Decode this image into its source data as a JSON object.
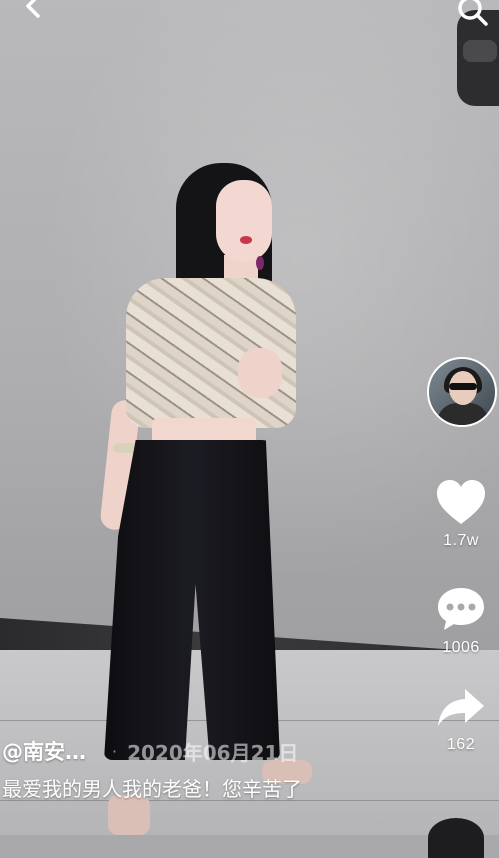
{
  "video": {
    "author": "@南安…",
    "separator": "·",
    "date": "2020年06月21日",
    "description": "最爱我的男人我的老爸！您辛苦了"
  },
  "actions": {
    "like_count": "1.7w",
    "comment_count": "1006",
    "share_count": "162"
  },
  "colors": {
    "overlay_text": "#ffffff",
    "date_text": "#d9d9d9"
  },
  "icons": {
    "back": "chevron-left-icon",
    "search": "search-icon",
    "like": "heart-icon",
    "comment": "speech-bubble-icon",
    "share": "share-arrow-icon"
  }
}
